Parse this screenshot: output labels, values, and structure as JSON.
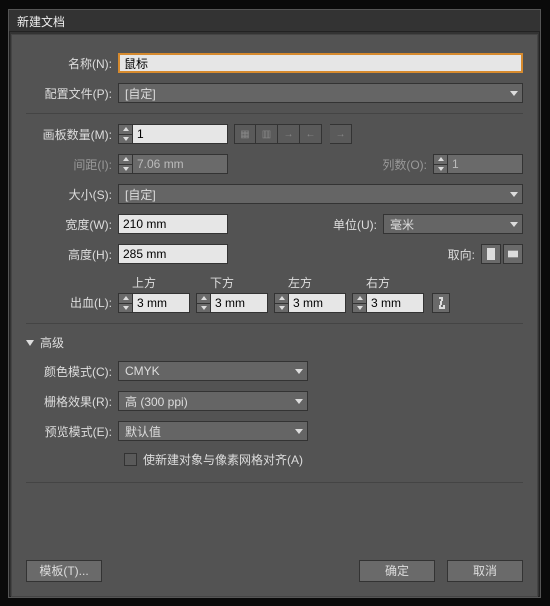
{
  "dialog": {
    "title": "新建文档"
  },
  "name": {
    "label": "名称(N):",
    "value": "鼠标"
  },
  "profile": {
    "label": "配置文件(P):",
    "value": "[自定]"
  },
  "artboards": {
    "count_label": "画板数量(M):",
    "count_value": "1",
    "spacing_label": "间距(I):",
    "spacing_value": "7.06 mm",
    "cols_label": "列数(O):",
    "cols_value": "1"
  },
  "size": {
    "label": "大小(S):",
    "value": "[自定]"
  },
  "width": {
    "label": "宽度(W):",
    "value": "210 mm"
  },
  "height": {
    "label": "高度(H):",
    "value": "285 mm"
  },
  "units": {
    "label": "单位(U):",
    "value": "毫米"
  },
  "orientation": {
    "label": "取向:"
  },
  "bleed": {
    "label": "出血(L):",
    "top_label": "上方",
    "top_value": "3 mm",
    "bottom_label": "下方",
    "bottom_value": "3 mm",
    "left_label": "左方",
    "left_value": "3 mm",
    "right_label": "右方",
    "right_value": "3 mm"
  },
  "advanced": {
    "header": "高级",
    "color_mode_label": "颜色模式(C):",
    "color_mode_value": "CMYK",
    "raster_label": "栅格效果(R):",
    "raster_value": "高 (300 ppi)",
    "preview_label": "预览模式(E):",
    "preview_value": "默认值",
    "align_label": "使新建对象与像素网格对齐(A)"
  },
  "footer": {
    "templates": "模板(T)...",
    "ok": "确定",
    "cancel": "取消"
  }
}
